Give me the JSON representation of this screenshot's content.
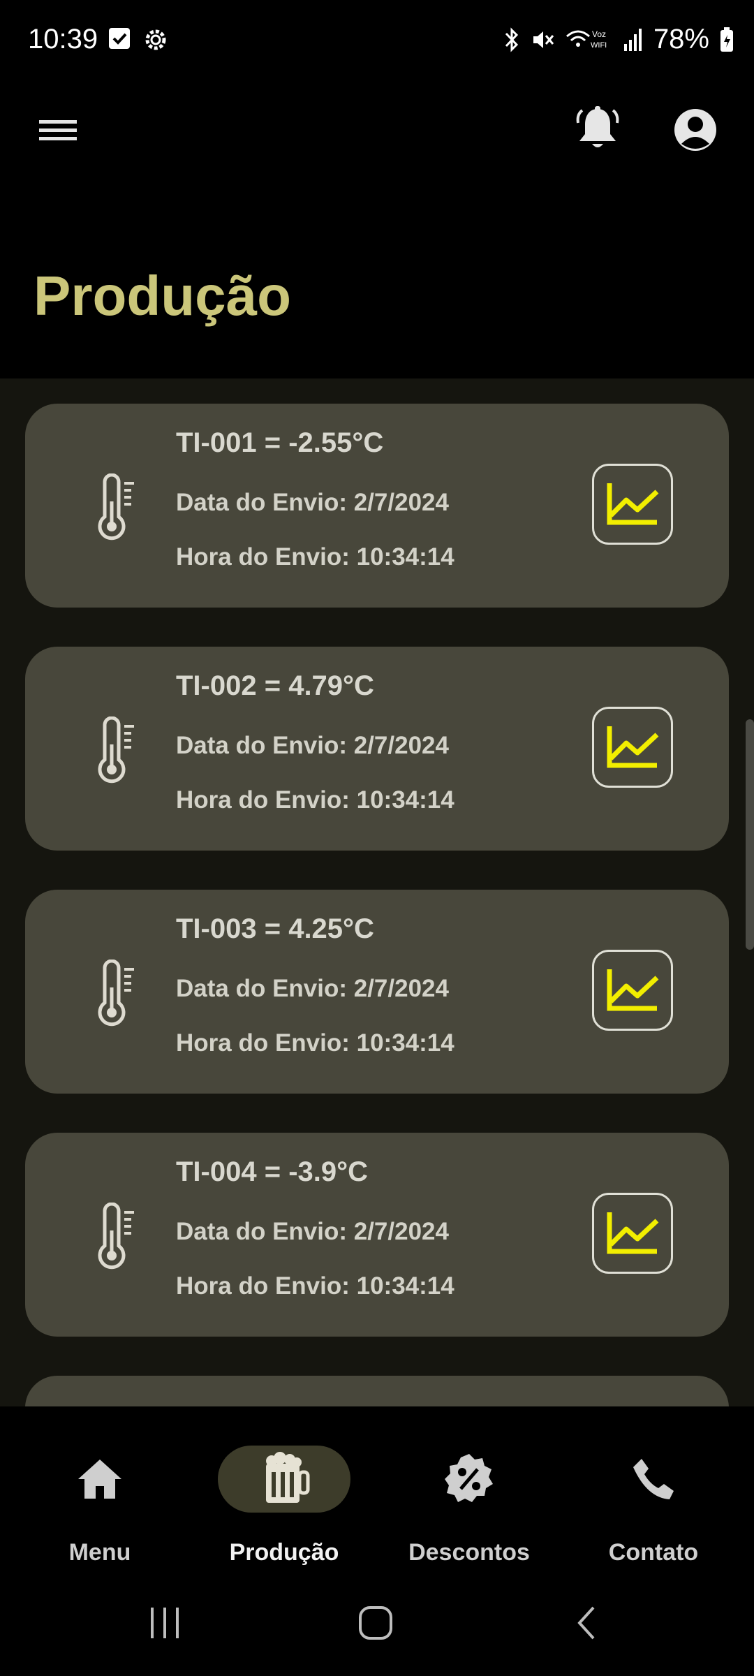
{
  "status_bar": {
    "time": "10:39",
    "battery": "78%",
    "icons": [
      "checkbox-notification-icon",
      "settings-gear-icon",
      "bluetooth-icon",
      "mute-icon",
      "wifi-calling-icon",
      "signal-icon",
      "battery-icon"
    ]
  },
  "app_bar": {
    "menu_icon": "hamburger-icon",
    "notifications_icon": "bell-icon",
    "profile_icon": "account-circle-icon"
  },
  "page": {
    "title": "Produção"
  },
  "sensors": [
    {
      "title": "TI-001 = -2.55°C",
      "date": "Data do Envio: 2/7/2024",
      "time": "Hora do Envio: 10:34:14"
    },
    {
      "title": "TI-002 = 4.79°C",
      "date": "Data do Envio: 2/7/2024",
      "time": "Hora do Envio: 10:34:14"
    },
    {
      "title": "TI-003 = 4.25°C",
      "date": "Data do Envio: 2/7/2024",
      "time": "Hora do Envio: 10:34:14"
    },
    {
      "title": "TI-004 = -3.9°C",
      "date": "Data do Envio: 2/7/2024",
      "time": "Hora do Envio: 10:34:14"
    }
  ],
  "bottom_nav": {
    "items": [
      {
        "label": "Menu",
        "icon": "home-icon"
      },
      {
        "label": "Produção",
        "icon": "beer-mug-icon",
        "active": true
      },
      {
        "label": "Descontos",
        "icon": "discount-badge-icon"
      },
      {
        "label": "Contato",
        "icon": "phone-icon"
      }
    ]
  },
  "colors": {
    "title": "#cbc67a",
    "card_bg": "#48473b",
    "content_bg": "#15150f",
    "chart_line": "#f2ee00",
    "active_pill": "#3d3c2a"
  }
}
